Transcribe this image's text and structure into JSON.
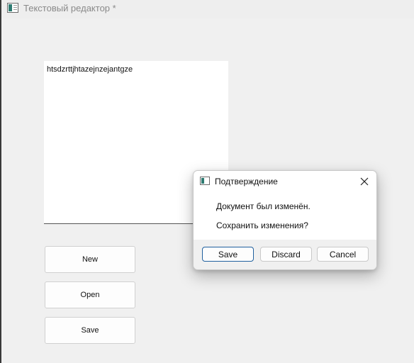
{
  "window": {
    "title": "Текстовый редактор *"
  },
  "editor": {
    "content": "htsdzrttjhtazejnzejantgze"
  },
  "buttons": {
    "new_label": "New",
    "open_label": "Open",
    "save_label": "Save"
  },
  "dialog": {
    "title": "Подтверждение",
    "message": "Документ был изменён.",
    "question": "Сохранить изменения?",
    "buttons": {
      "save": "Save",
      "discard": "Discard",
      "cancel": "Cancel"
    }
  }
}
